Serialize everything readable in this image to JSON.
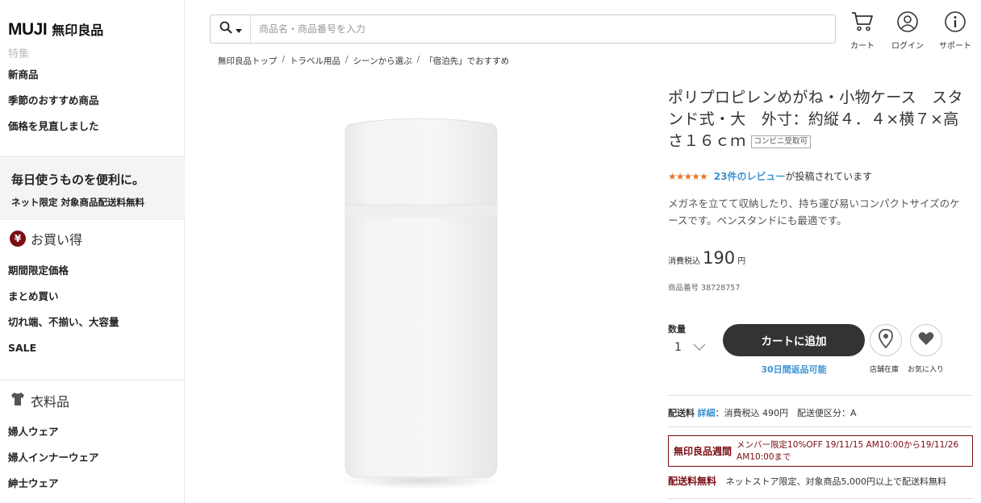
{
  "brand": {
    "name_en": "MUJI",
    "name_jp": "無印良品"
  },
  "sidebar": {
    "ghost_items": [
      "特集"
    ],
    "top_items": [
      {
        "label": "新商品"
      },
      {
        "label": "季節のおすすめ商品"
      },
      {
        "label": "価格を見直しました"
      }
    ],
    "promo": {
      "title": "毎日使うものを便利に。",
      "subtitle": "ネット限定 対象商品配送料無料"
    },
    "deals": {
      "heading": "お買い得",
      "badge": "¥",
      "items": [
        {
          "label": "期間限定価格"
        },
        {
          "label": "まとめ買い"
        },
        {
          "label": "切れ端、不揃い、大容量"
        },
        {
          "label": "SALE"
        }
      ]
    },
    "apparel": {
      "heading": "衣料品",
      "items": [
        {
          "label": "婦人ウェア"
        },
        {
          "label": "婦人インナーウェア"
        },
        {
          "label": "紳士ウェア"
        }
      ]
    }
  },
  "header": {
    "search": {
      "placeholder": "商品名・商品番号を入力",
      "value": ""
    },
    "cart_label": "カート",
    "login_label": "ログイン",
    "support_label": "サポート"
  },
  "breadcrumb": [
    "無印良品トップ",
    "トラベル用品",
    "シーンから選ぶ",
    "「宿泊先」でおすすめ"
  ],
  "product": {
    "title": "ポリプロピレンめがね・小物ケース　スタンド式・大　外寸：約縦４．４×横７×高さ１６ｃｍ",
    "badge": "コンビニ受取可",
    "rating": {
      "stars": "★★★★★",
      "value": 4.5,
      "review_link": "23件のレビュー",
      "review_suffix": "が投稿されています"
    },
    "description": "メガネを立てて収納したり、持ち運び易いコンパクトサイズのケースです。ペンスタンドにも最適です。",
    "price": {
      "label": "消費税込",
      "value": "190",
      "unit": "円"
    },
    "sku": "商品番号  38728757",
    "quantity": {
      "label": "数量",
      "value": "1"
    },
    "add_to_cart": "カートに追加",
    "return_policy": "30日間返品可能",
    "store_stock": "店舗在庫",
    "favorite": "お気に入り",
    "shipping": {
      "label": "配送料",
      "detail_link": "詳細",
      "text": "：消費税込 490円　配送便区分：A"
    },
    "week": {
      "tag": "無印良品週間",
      "text": "メンバー限定10%OFF 19/11/15 AM10:00から19/11/26 AM10:00まで"
    },
    "free_shipping": {
      "title": "配送料無料",
      "text": "ネットストア限定、対象商品5,000円以上で配送料無料"
    }
  },
  "colors": {
    "accent_red": "#7a0c14",
    "link_blue": "#3c94d3",
    "star_orange": "#e8762d",
    "button_dark": "#333333"
  }
}
